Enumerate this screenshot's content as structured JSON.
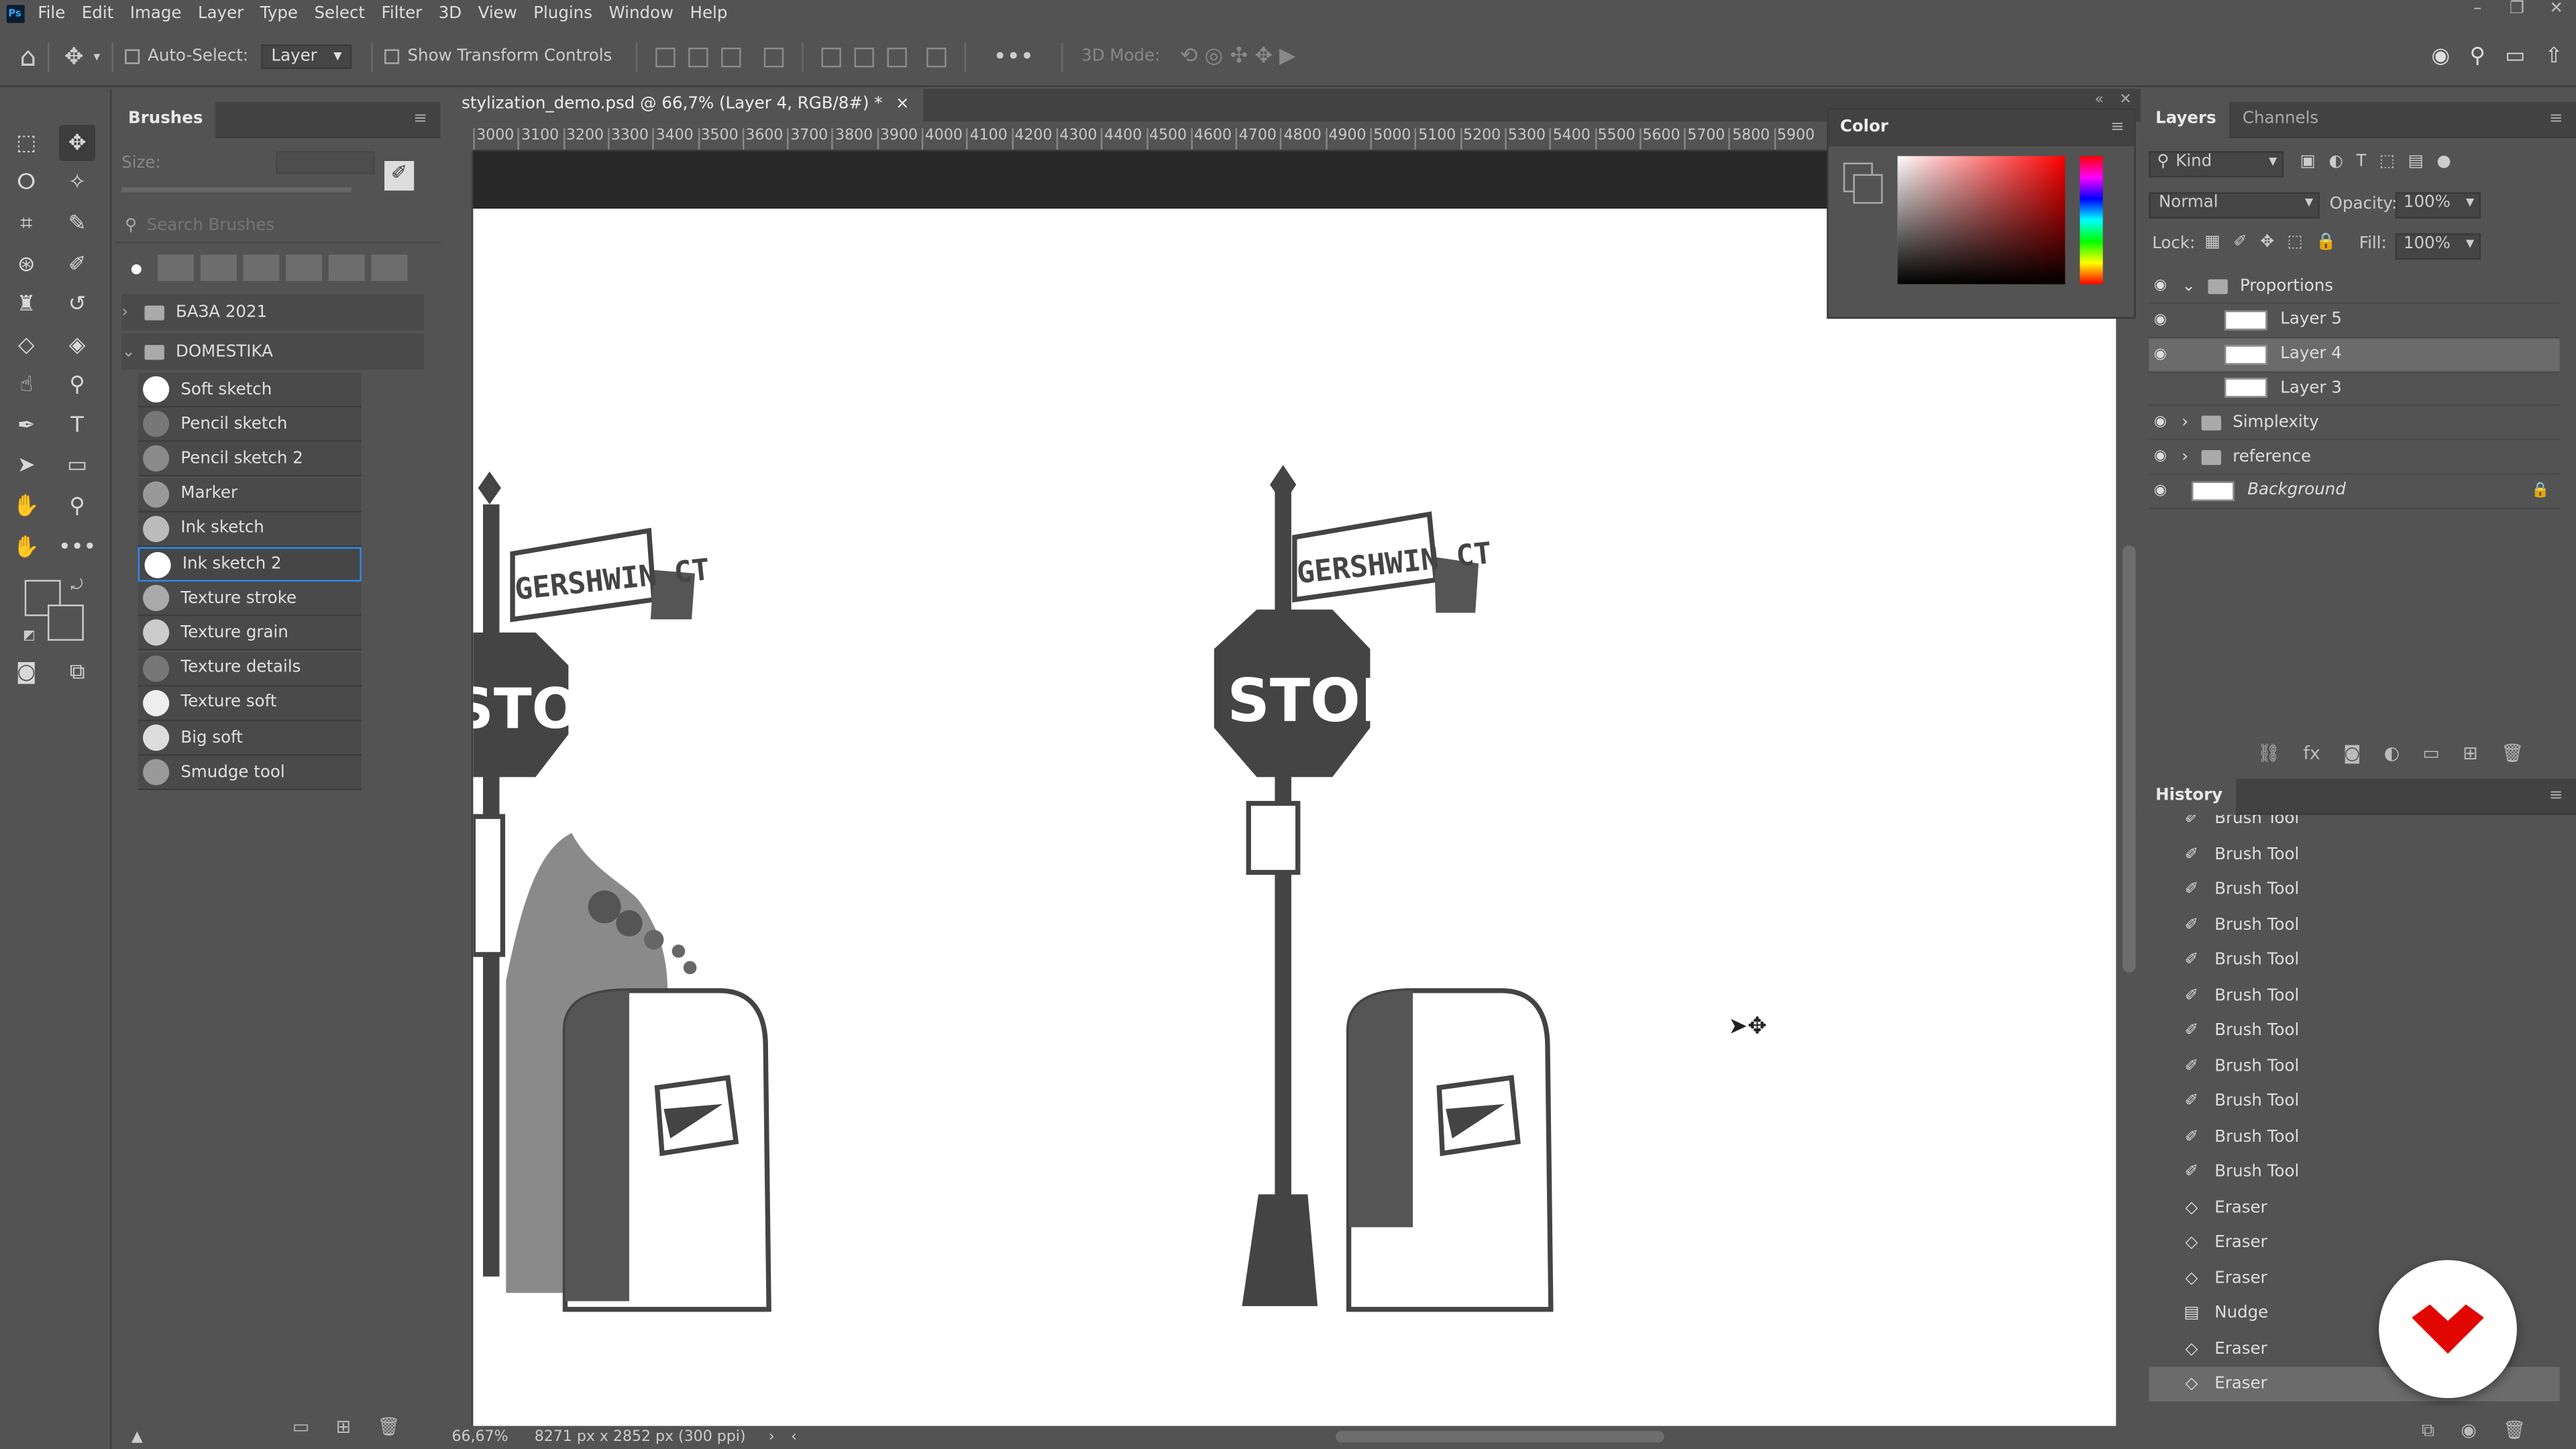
{
  "menubar": {
    "logo": "Ps",
    "items": [
      "File",
      "Edit",
      "Image",
      "Layer",
      "Type",
      "Select",
      "Filter",
      "3D",
      "View",
      "Plugins",
      "Window",
      "Help"
    ]
  },
  "options": {
    "auto_select": "Auto-Select:",
    "target": "Layer",
    "show_transform": "Show Transform Controls",
    "mode3d": "3D Mode:"
  },
  "brushes": {
    "title": "Brushes",
    "size_label": "Size:",
    "search_placeholder": "Search Brushes",
    "folders": [
      "БАЗА 2021",
      "DOMESTIKA"
    ],
    "items": [
      "Soft sketch",
      "Pencil sketch",
      "Pencil sketch 2",
      "Marker",
      "Ink sketch",
      "Ink sketch 2",
      "Texture stroke",
      "Texture grain",
      "Texture details",
      "Texture soft",
      "Big soft",
      "Smudge tool"
    ],
    "selected": "Ink sketch 2"
  },
  "document": {
    "tab": "stylization_demo.psd @ 66,7% (Layer 4, RGB/8#) *",
    "close": "×",
    "ruler": [
      "3000",
      "3100",
      "3200",
      "3300",
      "3400",
      "3500",
      "3600",
      "3700",
      "3800",
      "3900",
      "4000",
      "4100",
      "4200",
      "4300",
      "4400",
      "4500",
      "4600",
      "4700",
      "4800",
      "4900",
      "5000",
      "5100",
      "5200",
      "5300",
      "5400",
      "5500",
      "5600",
      "5700",
      "5800",
      "5900"
    ],
    "zoom": "66,67%",
    "dims": "8271 px x 2852 px (300 ppi)"
  },
  "art": {
    "sign_left": "GERSHWIN CT",
    "sign_right": "GERSHWIN CT",
    "stop": "STOP"
  },
  "color": {
    "title": "Color"
  },
  "layers": {
    "tabs": [
      "Layers",
      "Channels"
    ],
    "filter": "Kind",
    "blend": "Normal",
    "opacity_label": "Opacity:",
    "opacity": "100%",
    "lock_label": "Lock:",
    "fill_label": "Fill:",
    "fill": "100%",
    "rows": [
      {
        "name": "Proportions",
        "type": "group",
        "visible": true,
        "open": true
      },
      {
        "name": "Layer 5",
        "type": "layer",
        "visible": true
      },
      {
        "name": "Layer 4",
        "type": "layer",
        "visible": true,
        "selected": true
      },
      {
        "name": "Layer 3",
        "type": "layer",
        "visible": false
      },
      {
        "name": "Simplexity",
        "type": "group",
        "visible": true
      },
      {
        "name": "reference",
        "type": "group",
        "visible": true
      },
      {
        "name": "Background",
        "type": "bg",
        "visible": true
      }
    ]
  },
  "history": {
    "title": "History",
    "rows": [
      "Brush Tool",
      "Brush Tool",
      "Brush Tool",
      "Brush Tool",
      "Brush Tool",
      "Brush Tool",
      "Brush Tool",
      "Brush Tool",
      "Brush Tool",
      "Brush Tool",
      "Brush Tool",
      "Eraser",
      "Eraser",
      "Eraser",
      "Nudge",
      "Eraser",
      "Eraser"
    ]
  },
  "colors": {
    "accent": "#2d8ceb",
    "fab": "#e10600"
  }
}
